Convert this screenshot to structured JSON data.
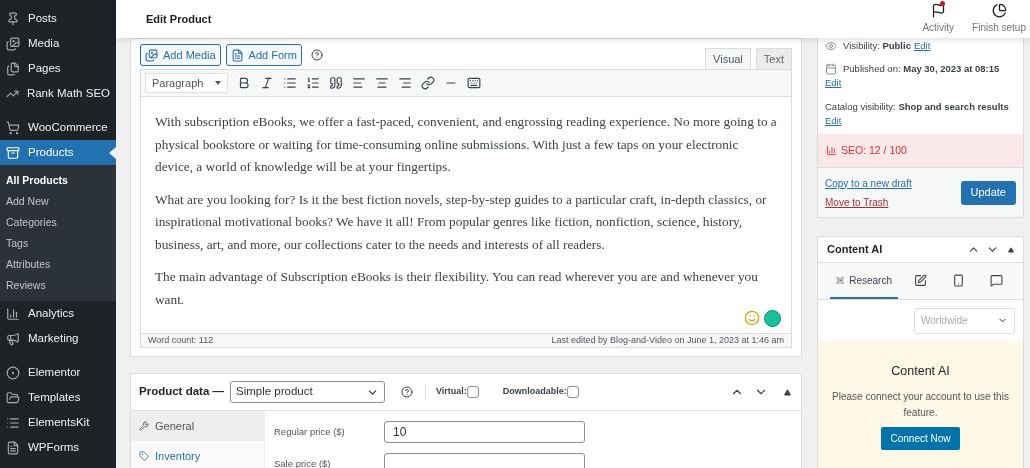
{
  "sidebar": {
    "groups": [
      [
        {
          "label": "Posts",
          "selected": false
        },
        {
          "label": "Media",
          "selected": false
        },
        {
          "label": "Pages",
          "selected": false
        },
        {
          "label": "Rank Math SEO",
          "selected": false
        }
      ],
      [
        {
          "label": "WooCommerce",
          "selected": false
        },
        {
          "label": "Products",
          "selected": true,
          "children": [
            {
              "label": "All Products",
              "selected": true
            },
            {
              "label": "Add New",
              "selected": false
            },
            {
              "label": "Categories",
              "selected": false
            },
            {
              "label": "Tags",
              "selected": false
            },
            {
              "label": "Attributes",
              "selected": false
            },
            {
              "label": "Reviews",
              "selected": false
            }
          ]
        },
        {
          "label": "Analytics",
          "selected": false
        },
        {
          "label": "Marketing",
          "selected": false
        }
      ],
      [
        {
          "label": "Elementor",
          "selected": false
        },
        {
          "label": "Templates",
          "selected": false
        },
        {
          "label": "ElementsKit",
          "selected": false
        },
        {
          "label": "WPForms",
          "selected": false
        }
      ]
    ]
  },
  "header": {
    "title": "Edit Product",
    "actions": [
      {
        "label": "Activity",
        "notification": true
      },
      {
        "label": "Finish setup",
        "notification": false
      }
    ]
  },
  "editor": {
    "media_buttons": [
      "Add Media",
      "Add Form"
    ],
    "mode_tabs": [
      {
        "label": "Visual",
        "selected": true
      },
      {
        "label": "Text",
        "selected": false
      }
    ],
    "format": "Paragraph",
    "paragraphs": [
      "With subscription eBooks, we offer a fast-paced, convenient, and engrossing reading experience. No more going to a physical bookstore or waiting for time-consuming online submissions. With just a few taps on your electronic device, a world of knowledge will be at your fingertips.",
      "What are you looking for? Is it the best fiction novels, step-by-step guides to a particular craft, in-depth classics, or inspirational motivational books? We have it all! From popular genres like fiction, nonfiction, science, history, business, art, and more, our collections cater to the needs and interests of all readers.",
      "The main advantage of Subscription eBooks is their flexibility. You can read wherever you are and whenever you want."
    ],
    "word_count": "Word count: 112",
    "last_edited": "Last edited by Blog-and-Video on June 1, 2023 at 1:46 am"
  },
  "product_data": {
    "title": "Product data —",
    "type": "Simple product",
    "options": [
      {
        "label": "Virtual:",
        "checked": false
      },
      {
        "label": "Downloadable:",
        "checked": false
      }
    ],
    "tabs": [
      {
        "label": "General",
        "selected": true
      },
      {
        "label": "Inventory",
        "selected": false
      }
    ],
    "fields": [
      {
        "label": "Regular price ($)",
        "value": "10"
      },
      {
        "label": "Sale price ($)"
      }
    ]
  },
  "publish": {
    "visibility_label": "Visibility:",
    "visibility": "Public",
    "visibility_edit": "Edit",
    "published_label": "Published on:",
    "published": "May 30, 2023 at 08:15",
    "published_edit": "Edit",
    "catalog_label": "Catalog visibility:",
    "catalog": "Shop and search results",
    "catalog_edit": "Edit",
    "seo": "SEO: 12 / 100",
    "copy_link": "Copy to a new draft",
    "trash_link": "Move to Trash",
    "update": "Update"
  },
  "content_ai": {
    "title": "Content AI",
    "tabs": [
      {
        "label": "Research",
        "selected": true
      },
      {
        "selected": false
      },
      {
        "selected": false
      },
      {
        "selected": false
      }
    ],
    "region": "Worldwide",
    "notice_title": "Content AI",
    "notice_text": "Please connect your account to use this feature.",
    "connect": "Connect Now"
  }
}
